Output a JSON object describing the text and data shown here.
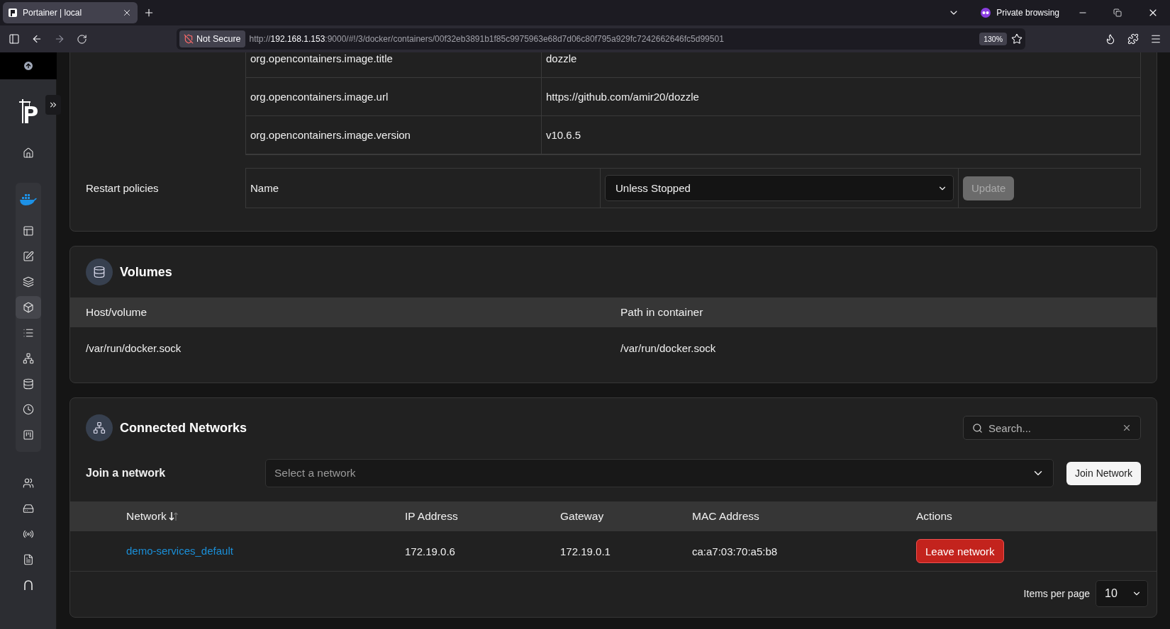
{
  "browser": {
    "tab_title": "Portainer | local",
    "security": "Not Secure",
    "url": [
      {
        "text": "http://",
        "highlight": false
      },
      {
        "text": "192.168.1.153",
        "highlight": true
      },
      {
        "text": ":9000/#!/3/docker/containers/00f32eb3891b1f85c9975963e68d7d06c80f795a929fc7242662646fc5d99501",
        "highlight": false
      }
    ],
    "zoom": "130%",
    "private_label": "Private browsing"
  },
  "sidebar": {
    "top_items": [
      {
        "selected": false
      }
    ],
    "environment_items": [
      {
        "selected": false
      },
      {
        "selected": false
      },
      {
        "selected": false
      },
      {
        "selected": true
      },
      {
        "selected": false
      },
      {
        "selected": false
      },
      {
        "selected": false
      },
      {
        "selected": false
      },
      {
        "selected": false
      }
    ],
    "settings_items": [
      {
        "selected": false
      },
      {
        "selected": false
      },
      {
        "selected": false
      },
      {
        "selected": false
      },
      {
        "selected": false
      }
    ]
  },
  "labels": [
    {
      "name": "org.opencontainers.image.title",
      "value": "dozzle"
    },
    {
      "name": "org.opencontainers.image.url",
      "value": "https://github.com/amir20/dozzle"
    },
    {
      "name": "org.opencontainers.image.version",
      "value": "v10.6.5"
    }
  ],
  "restart_policy": {
    "label": "Restart policies",
    "column": "Name",
    "value": "Unless Stopped",
    "button": "Update",
    "button_disabled": true
  },
  "volumes": {
    "title": "Volumes",
    "columns": [
      "Host/volume",
      "Path in container"
    ],
    "rows": [
      [
        "/var/run/docker.sock",
        "/var/run/docker.sock"
      ]
    ]
  },
  "networks": {
    "title": "Connected Networks",
    "search_placeholder": "Search...",
    "join_label": "Join a network",
    "join_placeholder": "Select a network",
    "join_button": "Join Network",
    "columns": [
      {
        "label": "Network",
        "sortable": true
      },
      {
        "label": "IP Address",
        "sortable": false
      },
      {
        "label": "Gateway",
        "sortable": false
      },
      {
        "label": "MAC Address",
        "sortable": false
      },
      {
        "label": "Actions",
        "sortable": false
      }
    ],
    "rows": [
      {
        "network": "demo-services_default",
        "ip": "172.19.0.6",
        "gateway": "172.19.0.1",
        "mac": "ca:a7:03:70:a5:b8",
        "action": "Leave network"
      }
    ],
    "items_per_page_label": "Items per page",
    "items_per_page": "10"
  }
}
